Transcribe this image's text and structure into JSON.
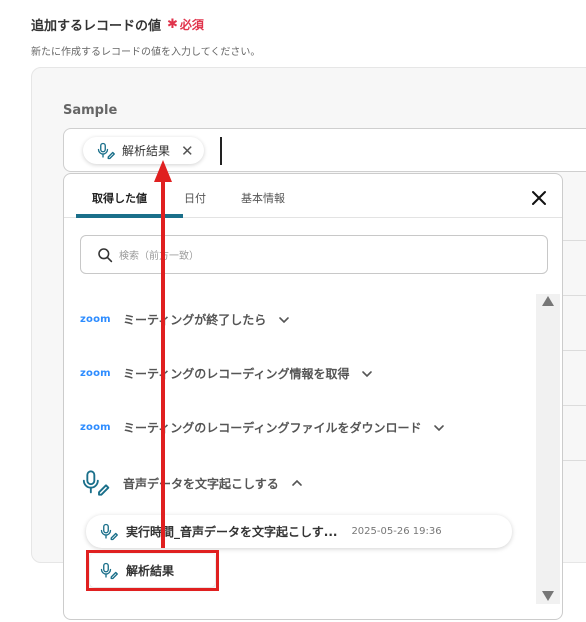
{
  "section": {
    "title": "追加するレコードの値",
    "required_mark": "✱",
    "required_label": "必須",
    "description": "新たに作成するレコードの値を入力してください。"
  },
  "field": {
    "label": "Sample",
    "chip_label": "解析結果",
    "chip_remove": "✕"
  },
  "dropdown": {
    "tabs": [
      "取得した値",
      "日付",
      "基本情報"
    ],
    "active_tab": 0,
    "search_placeholder": "検索（前方一致）",
    "groups": [
      {
        "logo": "zoom",
        "label": "ミーティングが終了したら",
        "expanded": false
      },
      {
        "logo": "zoom",
        "label": "ミーティングのレコーディング情報を取得",
        "expanded": false
      },
      {
        "logo": "zoom",
        "label": "ミーティングのレコーディングファイルをダウンロード",
        "expanded": false
      },
      {
        "logo": "",
        "label": "音声データを文字起こしする",
        "expanded": true
      }
    ],
    "items": [
      {
        "label": "実行時間_音声データを文字起こしす...",
        "timestamp": "2025-05-26 19:36"
      },
      {
        "label": "解析結果"
      }
    ]
  },
  "colors": {
    "accent": "#1a6f8a",
    "required": "#e0344c",
    "zoom": "#2d8cff",
    "annotation": "#e02020"
  },
  "icons": {
    "mic_pen": "mic-pen-icon",
    "search": "search-icon",
    "close": "close-icon",
    "chevron": "chevron-down-icon"
  }
}
